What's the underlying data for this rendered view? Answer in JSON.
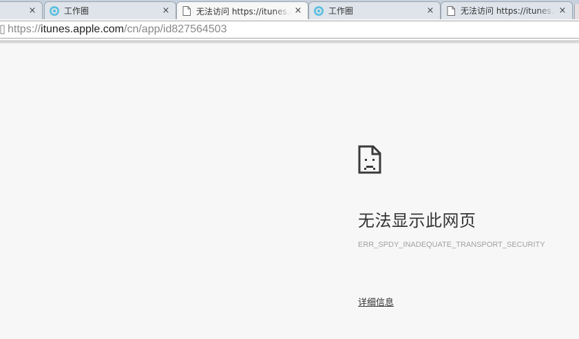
{
  "tabs": [
    {
      "title": "",
      "icon": "none",
      "close": "×"
    },
    {
      "title": "工作圈",
      "icon": "circle-logo-icon",
      "close": "×"
    },
    {
      "title": "无法访问 https://itunes.apple.com",
      "icon": "page-icon",
      "close": "×",
      "active": true
    },
    {
      "title": "工作圈",
      "icon": "circle-logo-icon",
      "close": "×"
    },
    {
      "title": "无法访问 https://itunes.apple.com",
      "icon": "page-icon",
      "close": "×"
    }
  ],
  "omnibox": {
    "scheme": "https://",
    "host": "itunes.apple.com",
    "path": "/cn/app/id827564503"
  },
  "error": {
    "heading": "无法显示此网页",
    "code": "ERR_SPDY_INADEQUATE_TRANSPORT_SECURITY",
    "details_link": "详细信息"
  },
  "colors": {
    "page_background": "#f7f7f7",
    "tab_strip": "#c7d1dd",
    "favicon_accent": "#5bc0de"
  }
}
